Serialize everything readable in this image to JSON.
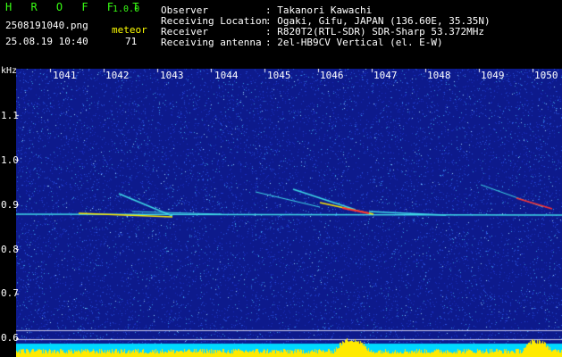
{
  "header": {
    "app_title": "H R O F F T",
    "version": "1.0.0",
    "filename": "2508191040.png",
    "datetime": "25.08.19 10:40",
    "meteor_label": "meteor",
    "meteor_count": "71"
  },
  "station_info": [
    {
      "label": "Observer",
      "value": ": Takanori Kawachi"
    },
    {
      "label": "Receiving Location",
      "value": ": Ogaki, Gifu, JAPAN (136.60E, 35.35N)"
    },
    {
      "label": "Receiver",
      "value": ": R820T2(RTL-SDR) SDR-Sharp 53.372MHz"
    },
    {
      "label": "Receiving antenna",
      "value": ": 2el-HB9CV Vertical (el. E-W)"
    }
  ],
  "axis": {
    "unit": "kHz",
    "minute_labels": [
      "1041",
      "1042",
      "1043",
      "1044",
      "1045",
      "1046",
      "1047",
      "1048",
      "1049",
      "1050"
    ],
    "frequency_labels": [
      "1.1",
      "1.0",
      "0.9",
      "0.8",
      "0.7",
      "0.6"
    ]
  },
  "colors": {
    "background_noise": "#0d1a8c",
    "trace_cyan": "#3fd9e8",
    "trace_yellow": "#ffea00",
    "trace_red": "#ff3030",
    "header_green": "#39ff14",
    "header_yellow": "#ffff00",
    "text_white": "#ffffff"
  }
}
